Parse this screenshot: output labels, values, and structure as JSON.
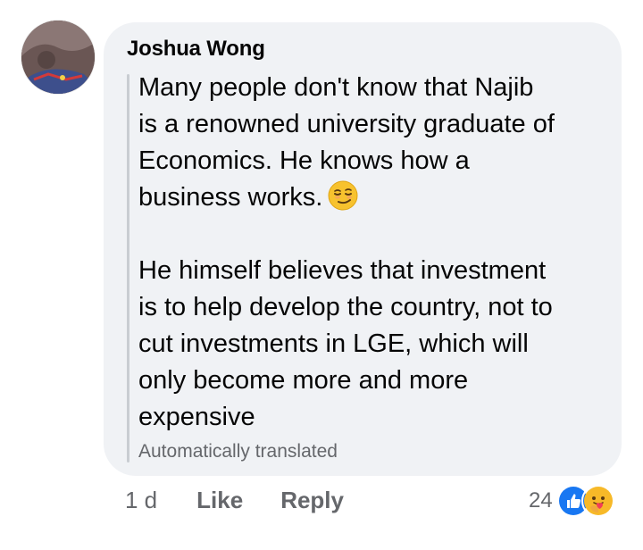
{
  "comment": {
    "author": "Joshua Wong",
    "paragraphs": [
      [
        "Many people don't know that Najib",
        "is a renowned university graduate of",
        "Economics. He knows how a",
        "business works."
      ],
      [
        "He himself believes that investment",
        "is to help develop the country, not to",
        "cut investments in LGE, which will",
        "only become more and more",
        "expensive"
      ]
    ],
    "emoji": "smirking-face-emoji",
    "translation_note": "Automatically translated"
  },
  "actions": {
    "timestamp": "1 d",
    "like_label": "Like",
    "reply_label": "Reply"
  },
  "reactions": {
    "count": "24",
    "icons": [
      "like-reaction-icon",
      "care-reaction-icon"
    ]
  },
  "colors": {
    "bubble": "#f0f2f5",
    "secondary_text": "#65676b",
    "like_blue": "#1877f2",
    "care_yellow": "#f7b928"
  }
}
